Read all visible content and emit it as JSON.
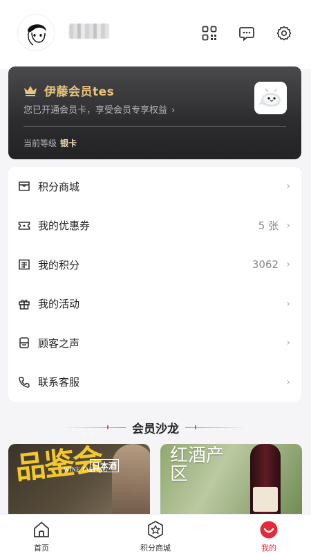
{
  "header": {
    "icons": [
      "qr-code-icon",
      "message-icon",
      "settings-gear-icon"
    ]
  },
  "vip_card": {
    "title": "伊藤会员tes",
    "subtitle": "您已开通会员卡，享受会员专享权益",
    "level_label": "当前等级",
    "level_value": "银卡",
    "accent_color": "#e8c47d"
  },
  "menu": {
    "items": [
      {
        "label": "积分商城",
        "value": "",
        "icon": "store-icon"
      },
      {
        "label": "我的优惠券",
        "value": "5 张",
        "icon": "coupon-icon"
      },
      {
        "label": "我的积分",
        "value": "3062",
        "icon": "points-icon"
      },
      {
        "label": "我的活动",
        "value": "",
        "icon": "gift-icon"
      },
      {
        "label": "顾客之声",
        "value": "",
        "icon": "feedback-icon"
      },
      {
        "label": "联系客服",
        "value": "",
        "icon": "phone-icon"
      }
    ]
  },
  "salon": {
    "title": "会员沙龙",
    "cards": [
      {
        "text": "品鉴会",
        "subtext": "日本酒",
        "caption": "WINE TASTING"
      },
      {
        "text": "红酒产区"
      }
    ]
  },
  "tabbar": {
    "tabs": [
      {
        "label": "首页",
        "icon": "home-icon"
      },
      {
        "label": "积分商城",
        "icon": "star-badge-icon"
      },
      {
        "label": "我的",
        "icon": "profile-smile-icon",
        "active": true
      }
    ],
    "active_color": "#e52a3a"
  }
}
